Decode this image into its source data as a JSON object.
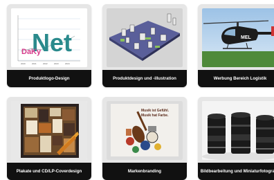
{
  "portfolio": {
    "items": [
      {
        "caption": "Produktlogo-Design",
        "logo_text": "Net",
        "logo_prefix": "DaKy"
      },
      {
        "caption": "Produktdesign und -illustration"
      },
      {
        "caption": "Werbung Bereich Logistik",
        "heli_text": "MEL"
      },
      {
        "caption": "Plakate und CD/LP-Coverdesign"
      },
      {
        "caption": "Markenbranding",
        "poster_text_1": "Musik ist Gefühl.",
        "poster_text_2": "Musik hat Farbe."
      },
      {
        "caption": "Bildbearbeitung und Miniaturfotografie"
      }
    ]
  }
}
